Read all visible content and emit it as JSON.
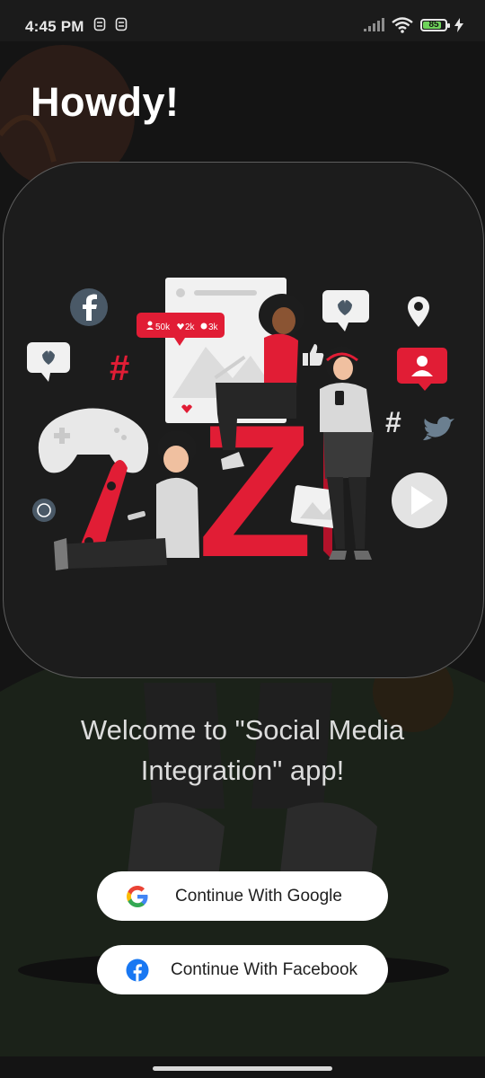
{
  "status_bar": {
    "time": "4:45 PM",
    "battery_level": "85",
    "battery_fraction": 0.85,
    "icons": [
      "notification-icon",
      "notification-icon",
      "signal-icon",
      "wifi-icon",
      "battery-icon",
      "charging-icon"
    ]
  },
  "header": {
    "title": "Howdy!"
  },
  "illustration": {
    "stats": {
      "followers": "50k",
      "likes": "2k",
      "comments": "3k"
    },
    "letter": "Z",
    "accent": "#e11d35"
  },
  "welcome_text": "Welcome to \"Social Media Integration\" app!",
  "buttons": {
    "google": {
      "label": "Continue With Google",
      "icon": "google-icon"
    },
    "facebook": {
      "label": "Continue With Facebook",
      "icon": "facebook-icon"
    }
  },
  "colors": {
    "background": "#141414",
    "card": "#1c1c1c",
    "button": "#ffffff",
    "facebook_blue": "#1877f2"
  }
}
